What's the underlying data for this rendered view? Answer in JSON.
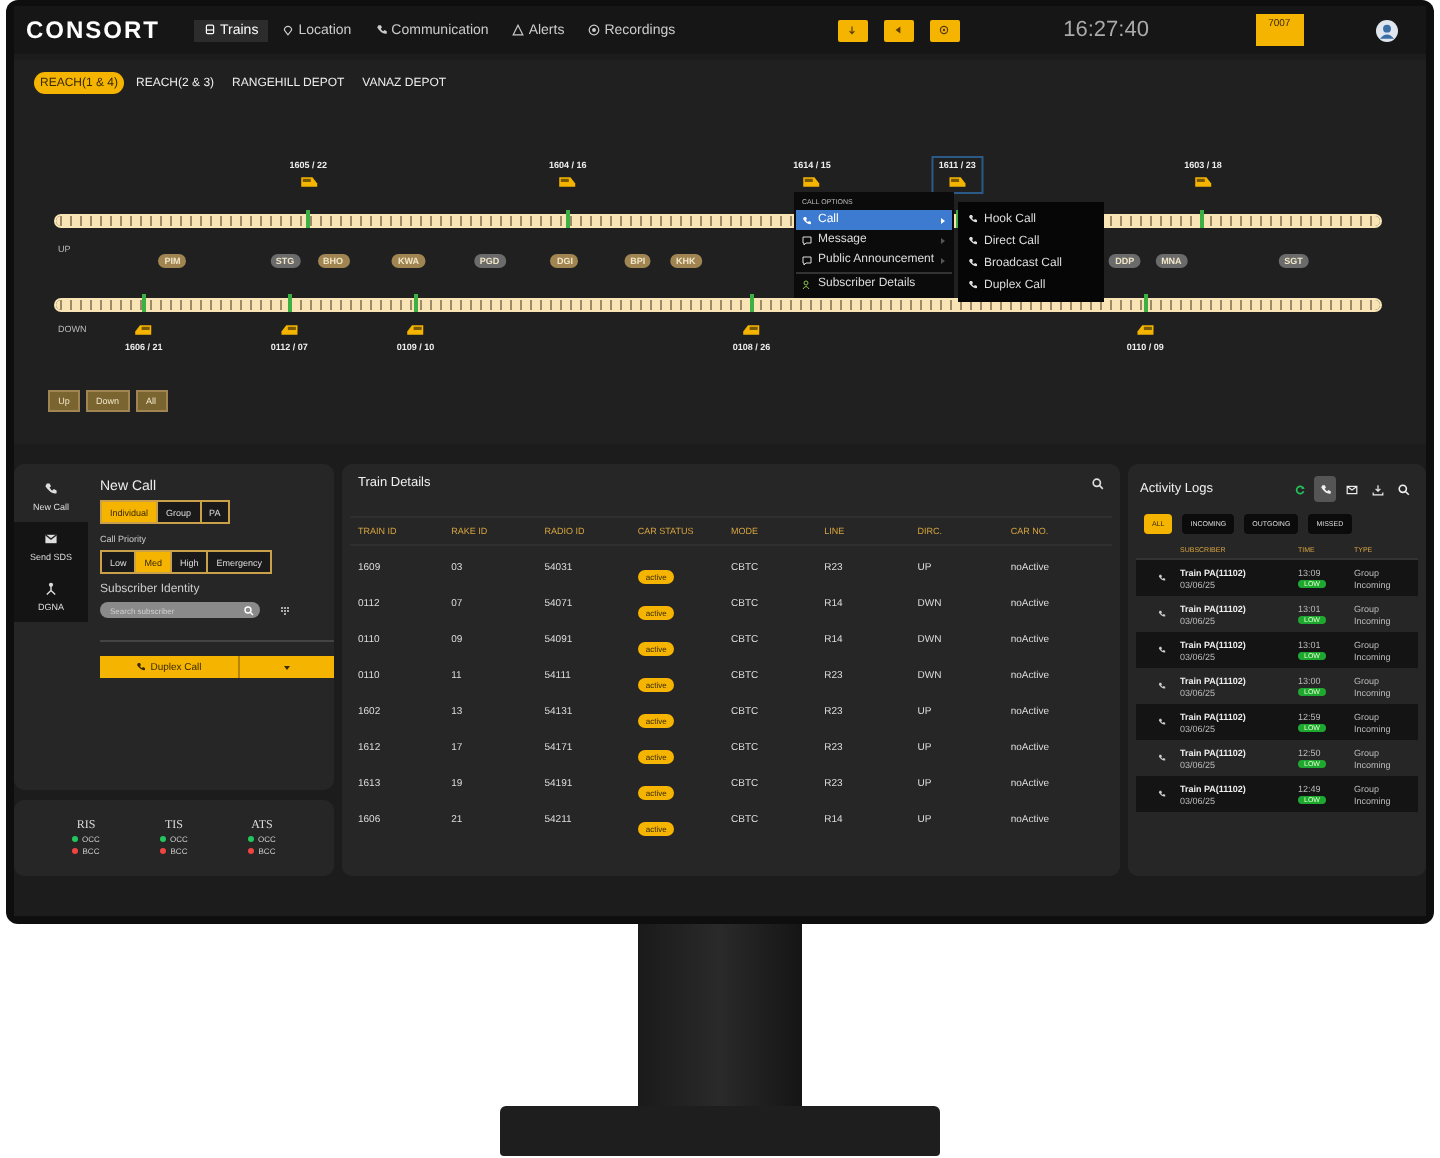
{
  "header": {
    "logo": "CONSORT",
    "tabs": [
      {
        "label": "Trains",
        "selected": true
      },
      {
        "label": "Location",
        "selected": false
      },
      {
        "label": "Communication",
        "selected": false
      },
      {
        "label": "Alerts",
        "selected": false
      },
      {
        "label": "Recordings",
        "selected": false
      }
    ],
    "clock": "16:27:40",
    "user_id": "7007"
  },
  "depot_tabs": [
    {
      "label": "REACH(1 & 4)",
      "selected": true
    },
    {
      "label": "REACH(2 & 3)",
      "selected": false
    },
    {
      "label": "RANGEHILL DEPOT",
      "selected": false
    },
    {
      "label": "VANAZ DEPOT",
      "selected": false
    }
  ],
  "map": {
    "up_label": "UP",
    "down_label": "DOWN",
    "up_trains": [
      {
        "label": "1605 / 22",
        "selected": false
      },
      {
        "label": "1604 / 16",
        "selected": false
      },
      {
        "label": "1614 / 15",
        "selected": false
      },
      {
        "label": "1611 / 23",
        "selected": true
      },
      {
        "label": "1603 / 18",
        "selected": false
      }
    ],
    "down_trains": [
      {
        "label": "1606 / 21",
        "selected": false
      },
      {
        "label": "0112 / 07",
        "selected": false
      },
      {
        "label": "0109 / 10",
        "selected": false
      },
      {
        "label": "0108 / 26",
        "selected": false
      },
      {
        "label": "0110 / 09",
        "selected": false
      }
    ],
    "stations": [
      {
        "code": "PIM",
        "color": "#a08552"
      },
      {
        "code": "STG",
        "color": "#6b6b6b"
      },
      {
        "code": "BHO",
        "color": "#a08552"
      },
      {
        "code": "KWA",
        "color": "#a08552"
      },
      {
        "code": "PGD",
        "color": "#6b6b6b"
      },
      {
        "code": "DGI",
        "color": "#a08552"
      },
      {
        "code": "BPI",
        "color": "#a08552"
      },
      {
        "code": "KHK",
        "color": "#a08552"
      },
      {
        "code": "DDP",
        "color": "#6b6b6b"
      },
      {
        "code": "MNA",
        "color": "#6b6b6b"
      },
      {
        "code": "SGT",
        "color": "#6b6b6b"
      }
    ],
    "direction_buttons": [
      "Up",
      "Down",
      "All"
    ]
  },
  "context_menu": {
    "header": "CALL OPTIONS",
    "items": [
      {
        "label": "Call",
        "selected": true,
        "has_submenu": true
      },
      {
        "label": "Message",
        "selected": false,
        "has_submenu": true
      },
      {
        "label": "Public Announcement",
        "selected": false,
        "has_submenu": true
      },
      {
        "label": "Subscriber Details",
        "selected": false,
        "has_submenu": false
      }
    ],
    "submenu": [
      "Hook Call",
      "Direct Call",
      "Broadcast Call",
      "Duplex Call"
    ]
  },
  "side_nav": [
    {
      "label": "New Call",
      "selected": true
    },
    {
      "label": "Send SDS",
      "selected": false
    },
    {
      "label": "DGNA",
      "selected": false
    }
  ],
  "new_call": {
    "title": "New Call",
    "call_types": [
      {
        "label": "Individual",
        "selected": true
      },
      {
        "label": "Group",
        "selected": false
      },
      {
        "label": "PA",
        "selected": false
      }
    ],
    "priority_label": "Call Priority",
    "priorities": [
      {
        "label": "Low",
        "selected": false
      },
      {
        "label": "Med",
        "selected": true
      },
      {
        "label": "High",
        "selected": false
      },
      {
        "label": "Emergency",
        "selected": false
      }
    ],
    "subscriber_label": "Subscriber Identity",
    "search_placeholder": "Search subscriber",
    "action": "Duplex Call"
  },
  "systems": [
    {
      "name": "RIS",
      "links": [
        {
          "label": "OCC",
          "color": "#22c55e"
        },
        {
          "label": "BCC",
          "color": "#ef4444"
        }
      ]
    },
    {
      "name": "TIS",
      "links": [
        {
          "label": "OCC",
          "color": "#22c55e"
        },
        {
          "label": "BCC",
          "color": "#ef4444"
        }
      ]
    },
    {
      "name": "ATS",
      "links": [
        {
          "label": "OCC",
          "color": "#22c55e"
        },
        {
          "label": "BCC",
          "color": "#ef4444"
        }
      ]
    }
  ],
  "train_details": {
    "title": "Train Details",
    "columns": [
      "TRAIN ID",
      "RAKE ID",
      "RADIO ID",
      "CAR STATUS",
      "MODE",
      "LINE",
      "DIRC.",
      "CAR NO."
    ],
    "rows": [
      [
        "1609",
        "03",
        "54031",
        "active",
        "CBTC",
        "R23",
        "UP",
        "noActive"
      ],
      [
        "0112",
        "07",
        "54071",
        "active",
        "CBTC",
        "R14",
        "DWN",
        "noActive"
      ],
      [
        "0110",
        "09",
        "54091",
        "active",
        "CBTC",
        "R14",
        "DWN",
        "noActive"
      ],
      [
        "0110",
        "11",
        "54111",
        "active",
        "CBTC",
        "R23",
        "DWN",
        "noActive"
      ],
      [
        "1602",
        "13",
        "54131",
        "active",
        "CBTC",
        "R23",
        "UP",
        "noActive"
      ],
      [
        "1612",
        "17",
        "54171",
        "active",
        "CBTC",
        "R23",
        "UP",
        "noActive"
      ],
      [
        "1613",
        "19",
        "54191",
        "active",
        "CBTC",
        "R23",
        "UP",
        "noActive"
      ],
      [
        "1606",
        "21",
        "54211",
        "active",
        "CBTC",
        "R14",
        "UP",
        "noActive"
      ]
    ]
  },
  "activity_logs": {
    "title": "Activity Logs",
    "tools": [
      {
        "kind": "refresh",
        "selected": false
      },
      {
        "kind": "phone",
        "selected": true
      },
      {
        "kind": "mail",
        "selected": false
      },
      {
        "kind": "download",
        "selected": false
      },
      {
        "kind": "search",
        "selected": false
      }
    ],
    "filters": [
      {
        "label": "ALL",
        "selected": true
      },
      {
        "label": "INCOMING",
        "selected": false
      },
      {
        "label": "OUTGOING",
        "selected": false
      },
      {
        "label": "MISSED",
        "selected": false
      }
    ],
    "columns": [
      "SUBSCRIBER",
      "TIME",
      "TYPE"
    ],
    "rows": [
      {
        "name": "Train PA(11102)",
        "date": "03/06/25",
        "time": "13:09",
        "priority": "LOW",
        "type": "Group",
        "direction": "Incoming"
      },
      {
        "name": "Train PA(11102)",
        "date": "03/06/25",
        "time": "13:01",
        "priority": "LOW",
        "type": "Group",
        "direction": "Incoming"
      },
      {
        "name": "Train PA(11102)",
        "date": "03/06/25",
        "time": "13:01",
        "priority": "LOW",
        "type": "Group",
        "direction": "Incoming"
      },
      {
        "name": "Train PA(11102)",
        "date": "03/06/25",
        "time": "13:00",
        "priority": "LOW",
        "type": "Group",
        "direction": "Incoming"
      },
      {
        "name": "Train PA(11102)",
        "date": "03/06/25",
        "time": "12:59",
        "priority": "LOW",
        "type": "Group",
        "direction": "Incoming"
      },
      {
        "name": "Train PA(11102)",
        "date": "03/06/25",
        "time": "12:50",
        "priority": "LOW",
        "type": "Group",
        "direction": "Incoming"
      },
      {
        "name": "Train PA(11102)",
        "date": "03/06/25",
        "time": "12:49",
        "priority": "LOW",
        "type": "Group",
        "direction": "Incoming"
      }
    ]
  }
}
